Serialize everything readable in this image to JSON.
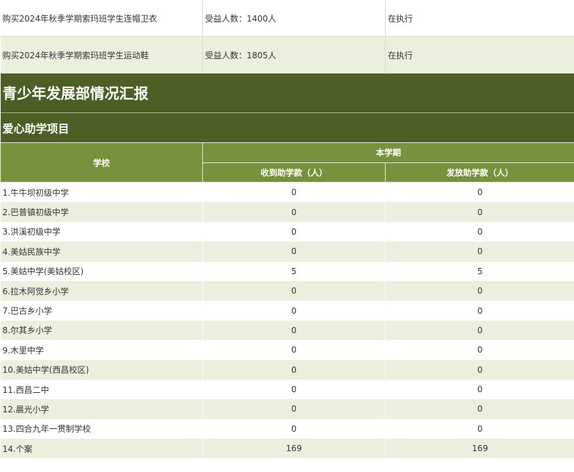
{
  "projects": [
    {
      "name": "购买2024年秋季学期索玛班学生连帽卫衣",
      "beneficiaries": "受益人数：1400人",
      "status": "在执行"
    },
    {
      "name": "购买2024年秋季学期索玛班学生运动鞋",
      "beneficiaries": "受益人数：1805人",
      "status": "在执行"
    }
  ],
  "department_title": "青少年发展部情况汇报",
  "section_title": "爱心助学项目",
  "table": {
    "school_header": "学校",
    "period_header": "本学期",
    "received_header": "收到助学款（人）",
    "distributed_header": "发放助学款（人）",
    "rows": [
      {
        "school": "1.牛牛坝初级中学",
        "received": "0",
        "distributed": "0"
      },
      {
        "school": "2.巴普镇初级中学",
        "received": "0",
        "distributed": "0"
      },
      {
        "school": "3.洪溪初级中学",
        "received": "0",
        "distributed": "0"
      },
      {
        "school": "4.美姑民族中学",
        "received": "0",
        "distributed": "0"
      },
      {
        "school": "5.美姑中学(美姑校区)",
        "received": "5",
        "distributed": "5"
      },
      {
        "school": "6.拉木阿觉乡小学",
        "received": "0",
        "distributed": "0"
      },
      {
        "school": "7.巴古乡小学",
        "received": "0",
        "distributed": "0"
      },
      {
        "school": "8.尔其乡小学",
        "received": "0",
        "distributed": "0"
      },
      {
        "school": "9.木里中学",
        "received": "0",
        "distributed": "0"
      },
      {
        "school": "10.美姑中学(西昌校区)",
        "received": "0",
        "distributed": "0"
      },
      {
        "school": "11.西昌二中",
        "received": "0",
        "distributed": "0"
      },
      {
        "school": "12.晨光小学",
        "received": "0",
        "distributed": "0"
      },
      {
        "school": "13.四合九年一贯制学校",
        "received": "0",
        "distributed": "0"
      },
      {
        "school": "14.个案",
        "received": "169",
        "distributed": "169"
      }
    ]
  },
  "colors": {
    "dark_band": "#4d5f24",
    "header_green": "#76923c",
    "row_tint": "#ebefde"
  }
}
